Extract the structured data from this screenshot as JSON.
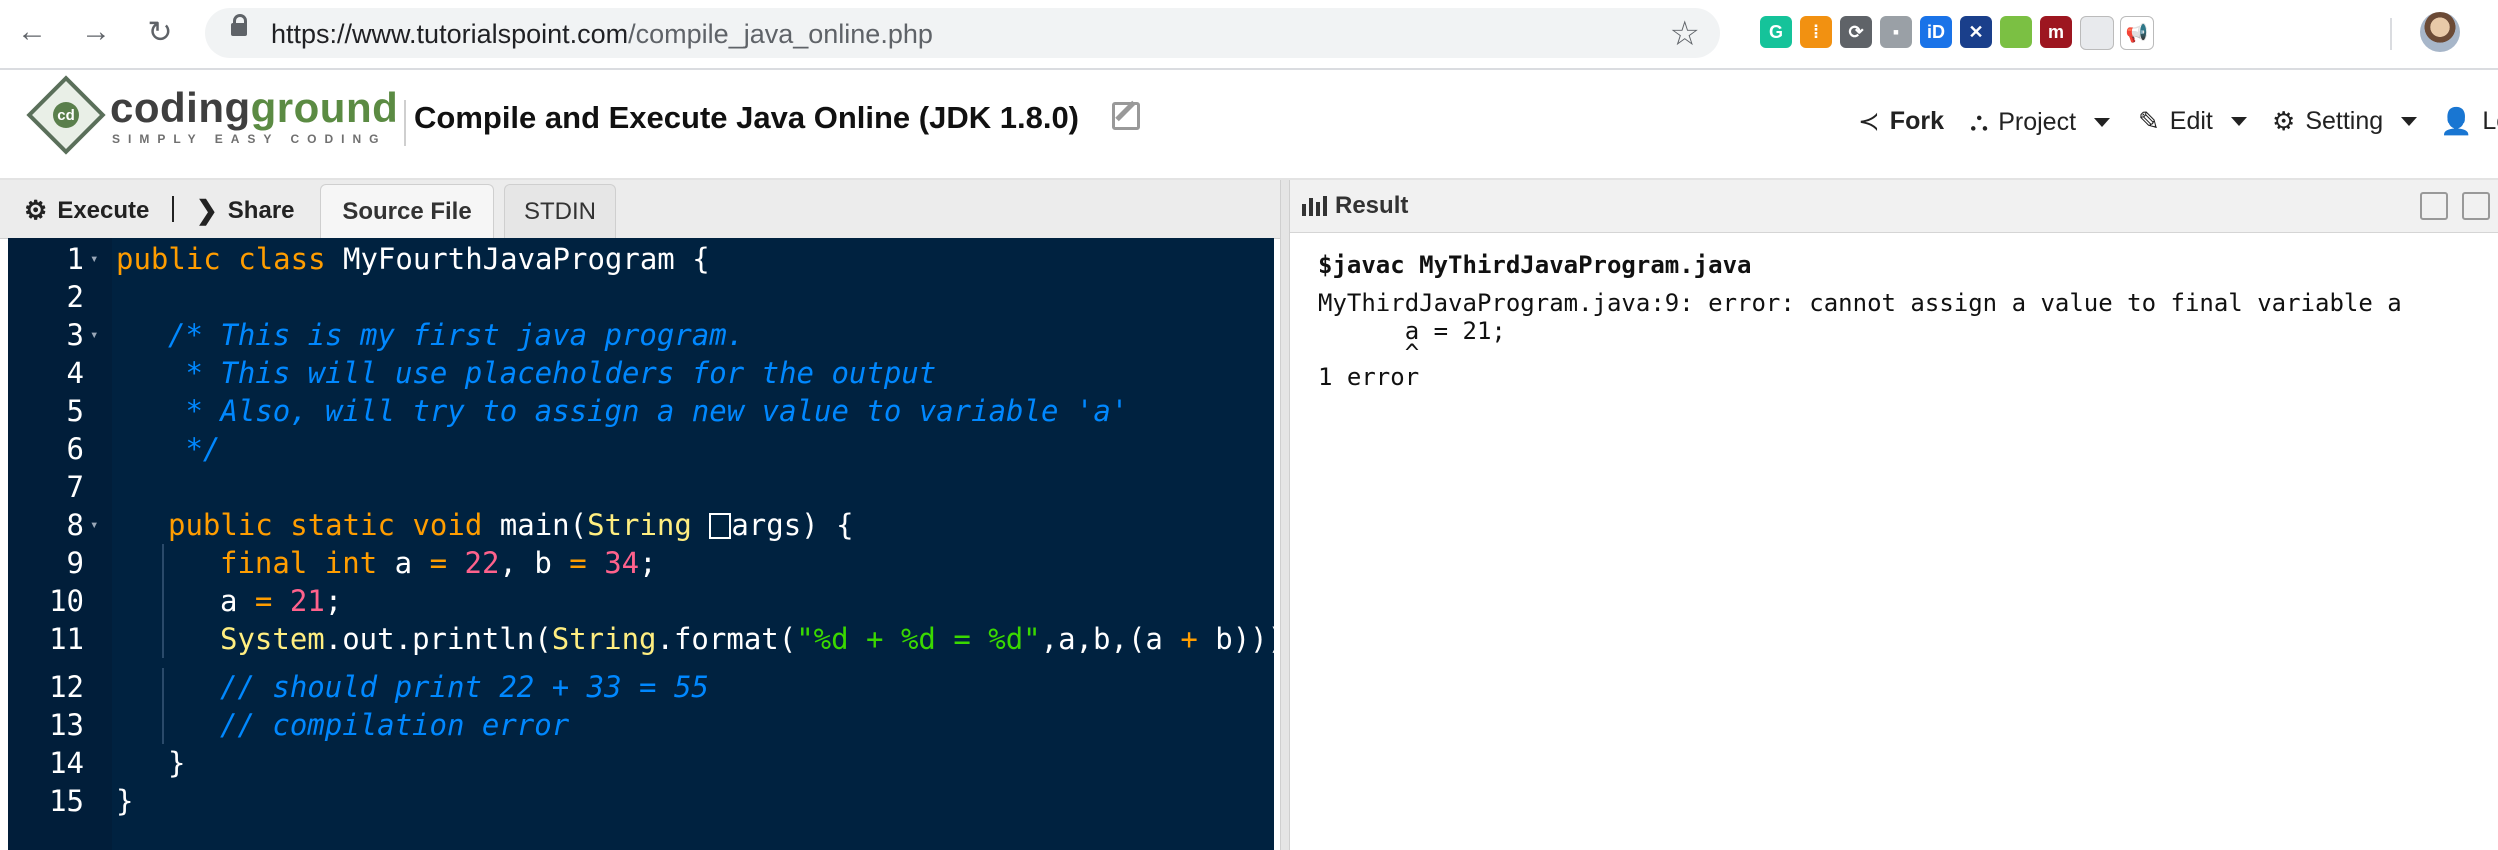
{
  "browser": {
    "url_host": "https://www.tutorialspoint.com",
    "url_path": "/compile_java_online.php",
    "extensions": [
      {
        "name": "grammarly-icon",
        "glyph": "G",
        "color": "#15c39a"
      },
      {
        "name": "extension-orange-icon",
        "glyph": "⁞",
        "color": "#f29111"
      },
      {
        "name": "refresh-extension-icon",
        "glyph": "⟳",
        "color": "#5f6368"
      },
      {
        "name": "chat-extension-icon",
        "glyph": "▪",
        "color": "#9aa0a6"
      },
      {
        "name": "id-extension-icon",
        "glyph": "iD",
        "color": "#1a73e8"
      },
      {
        "name": "x-extension-icon",
        "glyph": "✕",
        "color": "#1a3f8b"
      },
      {
        "name": "color-extension-icon",
        "glyph": "",
        "color": "#7bc043"
      },
      {
        "name": "mendeley-extension-icon",
        "glyph": "m",
        "color": "#9d1620"
      },
      {
        "name": "document-extension-icon",
        "glyph": "",
        "color": "#e8eaed"
      },
      {
        "name": "megaphone-extension-icon",
        "glyph": "📢",
        "color": "#ffffff"
      }
    ]
  },
  "header": {
    "logo_part1": "coding",
    "logo_part2": "ground",
    "logo_tagline": "SIMPLY EASY CODING",
    "page_title": "Compile and Execute Java Online (JDK 1.8.0)",
    "menu": {
      "fork": "Fork",
      "project": "Project",
      "edit": "Edit",
      "setting": "Setting",
      "login": "Lo"
    }
  },
  "toolbar": {
    "execute": "Execute",
    "share": "Share",
    "tab_source": "Source File",
    "tab_stdin": "STDIN"
  },
  "editor": {
    "lines": [
      {
        "n": "1",
        "fold": true,
        "indent": 0,
        "tokens": [
          [
            "kw",
            "public"
          ],
          [
            "pl",
            " "
          ],
          [
            "kw",
            "class"
          ],
          [
            "pl",
            " MyFourthJavaProgram {"
          ]
        ]
      },
      {
        "n": "2",
        "fold": false,
        "indent": 0,
        "tokens": []
      },
      {
        "n": "3",
        "fold": true,
        "indent": 1,
        "tokens": [
          [
            "cm",
            "/* This is my first java program."
          ]
        ]
      },
      {
        "n": "4",
        "fold": false,
        "indent": 1,
        "tokens": [
          [
            "cm",
            " * This will use placeholders for the output"
          ]
        ]
      },
      {
        "n": "5",
        "fold": false,
        "indent": 1,
        "tokens": [
          [
            "cm",
            " * Also, will try to assign a new value to variable 'a'"
          ]
        ]
      },
      {
        "n": "6",
        "fold": false,
        "indent": 1,
        "tokens": [
          [
            "cm",
            " */"
          ]
        ]
      },
      {
        "n": "7",
        "fold": false,
        "indent": 0,
        "tokens": []
      },
      {
        "n": "8",
        "fold": true,
        "indent": 1,
        "tokens": [
          [
            "kw",
            "public"
          ],
          [
            "pl",
            " "
          ],
          [
            "kw",
            "static"
          ],
          [
            "pl",
            " "
          ],
          [
            "kw",
            "void"
          ],
          [
            "pl",
            " main("
          ],
          [
            "ty",
            "String"
          ],
          [
            "pl",
            " "
          ],
          [
            "glyph",
            ""
          ],
          [
            "pl",
            "args) {"
          ]
        ]
      },
      {
        "n": "9",
        "fold": false,
        "indent": 2,
        "tokens": [
          [
            "kw",
            "final"
          ],
          [
            "pl",
            " "
          ],
          [
            "kw",
            "int"
          ],
          [
            "pl",
            " a "
          ],
          [
            "op",
            "="
          ],
          [
            "pl",
            " "
          ],
          [
            "num",
            "22"
          ],
          [
            "pl",
            ", b "
          ],
          [
            "op",
            "="
          ],
          [
            "pl",
            " "
          ],
          [
            "num",
            "34"
          ],
          [
            "pl",
            ";"
          ]
        ]
      },
      {
        "n": "10",
        "fold": false,
        "indent": 2,
        "tokens": [
          [
            "pl",
            "a "
          ],
          [
            "op",
            "="
          ],
          [
            "pl",
            " "
          ],
          [
            "num",
            "21"
          ],
          [
            "pl",
            ";"
          ]
        ]
      },
      {
        "n": "11",
        "fold": false,
        "indent": 2,
        "tokens": [
          [
            "ty",
            "System"
          ],
          [
            "pl",
            ".out.println("
          ],
          [
            "ty",
            "String"
          ],
          [
            "pl",
            ".format("
          ],
          [
            "str",
            "\"%d + %d = %d\""
          ],
          [
            "pl",
            ",a,b,(a "
          ],
          [
            "op",
            "+"
          ],
          [
            "pl",
            " b)));"
          ]
        ]
      },
      {
        "n": "12",
        "fold": false,
        "indent": 2,
        "gap": true,
        "tokens": [
          [
            "cm",
            "// should print 22 + 33 = 55"
          ]
        ]
      },
      {
        "n": "13",
        "fold": false,
        "indent": 2,
        "tokens": [
          [
            "cm",
            "// compilation error"
          ]
        ]
      },
      {
        "n": "14",
        "fold": false,
        "indent": 1,
        "tokens": [
          [
            "pl",
            "}"
          ]
        ]
      },
      {
        "n": "15",
        "fold": false,
        "indent": 0,
        "tokens": [
          [
            "pl",
            "}"
          ]
        ]
      }
    ]
  },
  "result": {
    "title": "Result",
    "command": "$javac MyThirdJavaProgram.java",
    "error_line": "MyThirdJavaProgram.java:9: error: cannot assign a value to final variable a",
    "code_line": "      a = 21;",
    "caret_line": "      ^",
    "summary": "1 error"
  }
}
